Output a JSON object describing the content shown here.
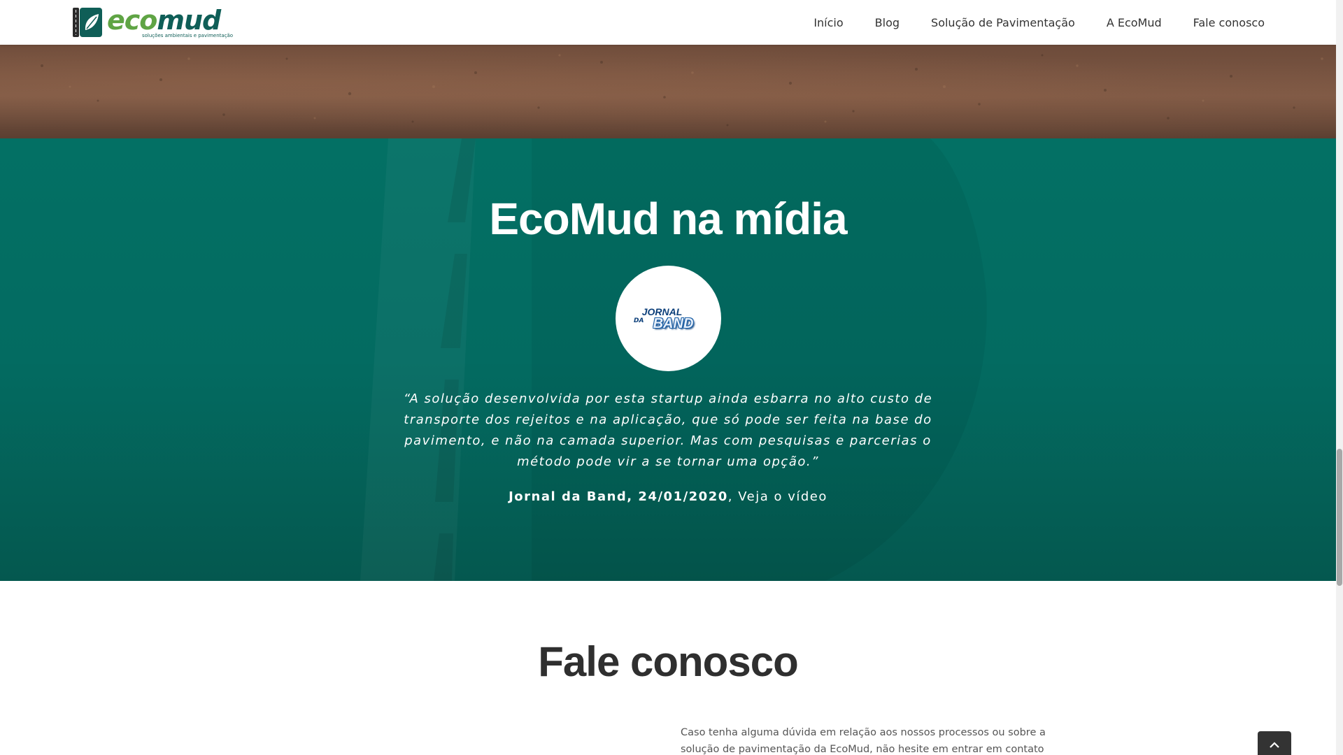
{
  "header": {
    "logo": {
      "word_eco": "eco",
      "word_mud": "mud",
      "tagline": "soluções ambientais e pavimentação"
    },
    "nav": [
      "Início",
      "Blog",
      "Solução de Pavimentação",
      "A EcoMud",
      "Fale conosco"
    ]
  },
  "media": {
    "title": "EcoMud na mídia",
    "badge": {
      "line1": "JORNAL",
      "da": "DA",
      "line2": "BAND"
    },
    "quote": "“A solução desenvolvida por esta startup ainda esbarra no alto custo de transporte dos rejeitos e na aplicação, que só pode ser feita na base do pavimento, e não na camada superior. Mas com pesquisas e parcerias o método pode vir a se tornar uma opção.”",
    "source": "Jornal da Band, 24/01/2020",
    "separator": ", ",
    "video_link": "Veja o vídeo"
  },
  "contact": {
    "title": "Fale conosco",
    "text": "Caso tenha alguma dúvida em relação aos nossos processos ou sobre a solução de pavimentação da EcoMud, não hesite em entrar em contato conosco através"
  },
  "colors": {
    "teal": "#037064",
    "brand_green": "#5fa444",
    "brand_dark": "#0f5e57",
    "text_dark": "#2f2f2f"
  },
  "icons": {
    "logo": "ecomud-logo-icon",
    "to_top": "chevron-up-icon"
  }
}
